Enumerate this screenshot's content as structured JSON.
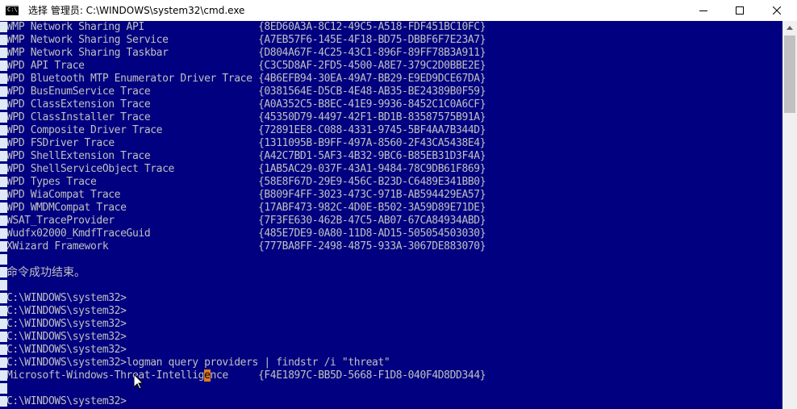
{
  "window": {
    "title": "选择 管理员: C:\\WINDOWS\\system32\\cmd.exe",
    "app_icon_text": "C:\\",
    "minimize_icon": "minimize-icon",
    "maximize_icon": "maximize-icon",
    "close_icon": "close-icon"
  },
  "colors": {
    "console_bg": "#000080",
    "console_fg": "#c0c0c0",
    "selection": "#e07a1f"
  },
  "providers": [
    {
      "name": "WMP Network Sharing API",
      "guid": "{8ED60A3A-8C12-49C5-A518-FDF451BC10FC}"
    },
    {
      "name": "WMP Network Sharing Service",
      "guid": "{A7EB57F6-145E-4F18-BD75-DBBF6F7E23A7}"
    },
    {
      "name": "WMP Network Sharing Taskbar",
      "guid": "{D804A67F-4C25-43C1-896F-89FF78B3A911}"
    },
    {
      "name": "WPD API Trace",
      "guid": "{C3C5D8AF-2FD5-4500-A8E7-379C2D0BBE2E}"
    },
    {
      "name": "WPD Bluetooth MTP Enumerator Driver Trace",
      "guid": "{4B6EFB94-30EA-49A7-BB29-E9ED9DCE67DA}"
    },
    {
      "name": "WPD BusEnumService Trace",
      "guid": "{0381564E-D5CB-4E48-AB35-BE24389B0F59}"
    },
    {
      "name": "WPD ClassExtension Trace",
      "guid": "{A0A352C5-B8EC-41E9-9936-8452C1C0A6CF}"
    },
    {
      "name": "WPD ClassInstaller Trace",
      "guid": "{45350D79-4497-42F1-BD1B-83587575B91A}"
    },
    {
      "name": "WPD Composite Driver Trace",
      "guid": "{72891EE8-C088-4331-9745-5BF4AA7B344D}"
    },
    {
      "name": "WPD FSDriver Trace",
      "guid": "{1311095B-B9FF-497A-8560-2F43CA5438E4}"
    },
    {
      "name": "WPD ShellExtension Trace",
      "guid": "{A42C7BD1-5AF3-4B32-9BC6-B85EB31D3F4A}"
    },
    {
      "name": "WPD ShellServiceObject Trace",
      "guid": "{1AB5AC29-037F-43A1-9484-78C9DB61F869}"
    },
    {
      "name": "WPD Types Trace",
      "guid": "{58E8F67D-29E9-456C-B23D-C6489E341BB0}"
    },
    {
      "name": "WPD WiaCompat Trace",
      "guid": "{B809F4FF-3023-473C-971B-AB594429EA57}"
    },
    {
      "name": "WPD WMDMCompat Trace",
      "guid": "{17ABF473-982C-4D0E-B502-3A59D89E71DE}"
    },
    {
      "name": "WSAT_TraceProvider",
      "guid": "{7F3FE630-462B-47C5-AB07-67CA84934ABD}"
    },
    {
      "name": "Wudfx02000_KmdfTraceGuid",
      "guid": "{485E7DE9-0A80-11D8-AD15-505054503030}"
    },
    {
      "name": "XWizard Framework",
      "guid": "{777BA8FF-2498-4875-933A-3067DE883070}"
    }
  ],
  "success_message": "命令成功结束。",
  "prompts": [
    "C:\\WINDOWS\\system32>",
    "C:\\WINDOWS\\system32>",
    "C:\\WINDOWS\\system32>",
    "C:\\WINDOWS\\system32>",
    "C:\\WINDOWS\\system32>"
  ],
  "command": {
    "prompt": "C:\\WINDOWS\\system32>",
    "text": "logman query providers | findstr /i \"threat\""
  },
  "result": {
    "name_before": "Microsoft-Windows-Threat-Intellig",
    "name_selected": "e",
    "name_after": "nce",
    "guid": "{F4E1897C-BB5D-5668-F1D8-040F4D8DD344}"
  },
  "final_prompt": "C:\\WINDOWS\\system32>"
}
